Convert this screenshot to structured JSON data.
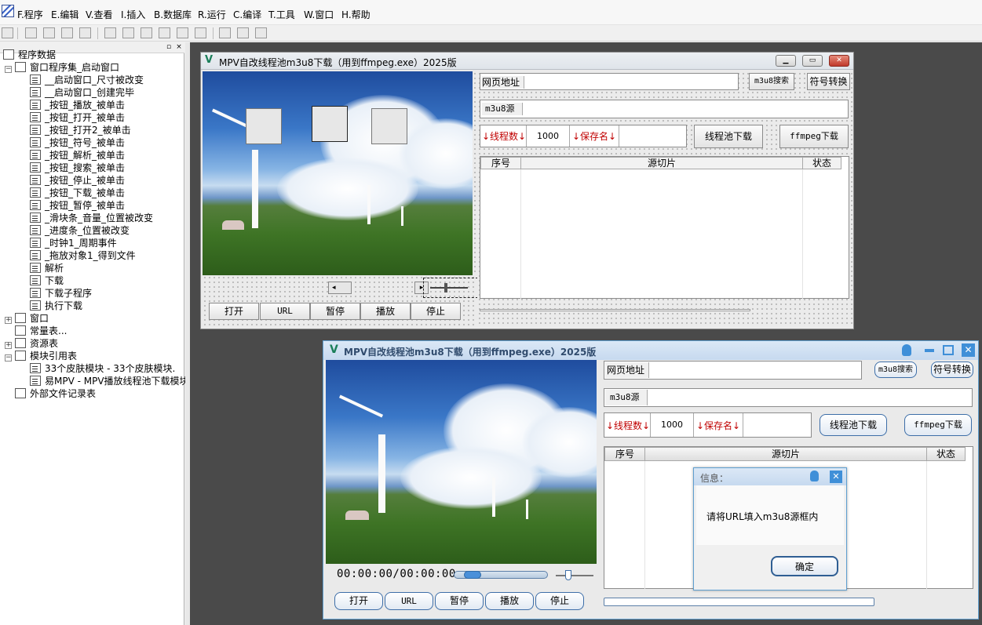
{
  "menubar": {
    "items": [
      "F.程序",
      "E.编辑",
      "V.查看",
      "I.插入",
      "B.数据库",
      "R.运行",
      "C.编译",
      "T.工具",
      "W.窗口",
      "H.帮助"
    ]
  },
  "left_panel": {
    "tree": [
      {
        "label": "程序数据",
        "level": 0,
        "expander": ""
      },
      {
        "label": "窗口程序集_启动窗口",
        "level": 1,
        "expander": "−"
      },
      {
        "label": "__启动窗口_尺寸被改变",
        "level": 2
      },
      {
        "label": "__启动窗口_创建完毕",
        "level": 2
      },
      {
        "label": "_按钮_播放_被单击",
        "level": 2
      },
      {
        "label": "_按钮_打开_被单击",
        "level": 2
      },
      {
        "label": "_按钮_打开2_被单击",
        "level": 2
      },
      {
        "label": "_按钮_符号_被单击",
        "level": 2
      },
      {
        "label": "_按钮_解析_被单击",
        "level": 2
      },
      {
        "label": "_按钮_搜索_被单击",
        "level": 2
      },
      {
        "label": "_按钮_停止_被单击",
        "level": 2
      },
      {
        "label": "_按钮_下载_被单击",
        "level": 2
      },
      {
        "label": "_按钮_暂停_被单击",
        "level": 2
      },
      {
        "label": "_滑块条_音量_位置被改变",
        "level": 2
      },
      {
        "label": "_进度条_位置被改变",
        "level": 2
      },
      {
        "label": "_时钟1_周期事件",
        "level": 2
      },
      {
        "label": "_拖放对象1_得到文件",
        "level": 2
      },
      {
        "label": "解析",
        "level": 2
      },
      {
        "label": "下载",
        "level": 2
      },
      {
        "label": "下载子程序",
        "level": 2
      },
      {
        "label": "执行下载",
        "level": 2
      },
      {
        "label": "窗口",
        "level": 1,
        "expander": "+"
      },
      {
        "label": "常量表...",
        "level": 1,
        "expander": ""
      },
      {
        "label": "资源表",
        "level": 1,
        "expander": "+"
      },
      {
        "label": "模块引用表",
        "level": 1,
        "expander": "−"
      },
      {
        "label": "33个皮肤模块 - 33个皮肤模块.",
        "level": 2
      },
      {
        "label": "易MPV - MPV播放线程池下载模块",
        "level": 2
      },
      {
        "label": "外部文件记录表",
        "level": 1,
        "expander": ""
      }
    ]
  },
  "design_window": {
    "title": "MPV自改线程池m3u8下载（用到ffmpeg.exe）2025版",
    "url_label": "网页地址",
    "search_btn": "m3u8搜索",
    "convert_btn": "符号转换",
    "m3u8_label": "m3u8源",
    "threads_label": "↓线程数↓",
    "threads_value": "1000",
    "savename_label": "↓保存名↓",
    "pool_btn": "线程池下载",
    "ffmpeg_btn": "ffmpeg下载",
    "col_index": "序号",
    "col_source": "源切片",
    "col_status": "状态",
    "btn_open": "打开",
    "btn_url": "URL",
    "btn_pause": "暂停",
    "btn_play": "播放",
    "btn_stop": "停止"
  },
  "run_window": {
    "title": "MPV自改线程池m3u8下载（用到ffmpeg.exe）2025版",
    "url_label": "网页地址",
    "search_btn": "m3u8搜索",
    "convert_btn": "符号转换",
    "m3u8_label": "m3u8源",
    "threads_label": "↓线程数↓",
    "threads_value": "1000",
    "savename_label": "↓保存名↓",
    "pool_btn": "线程池下载",
    "ffmpeg_btn": "ffmpeg下载",
    "col_index": "序号",
    "col_source": "源切片",
    "col_status": "状态",
    "time": "00:00:00/00:00:00",
    "btn_open": "打开",
    "btn_url": "URL",
    "btn_pause": "暂停",
    "btn_play": "播放",
    "btn_stop": "停止"
  },
  "dialog": {
    "title": "信息：",
    "message": "请将URL填入m3u8源框内",
    "ok": "确定"
  },
  "colors": {
    "accent_red": "#c00000",
    "run_title_bg": "#c6d9ef",
    "run_button_border": "#3d6ea8"
  }
}
